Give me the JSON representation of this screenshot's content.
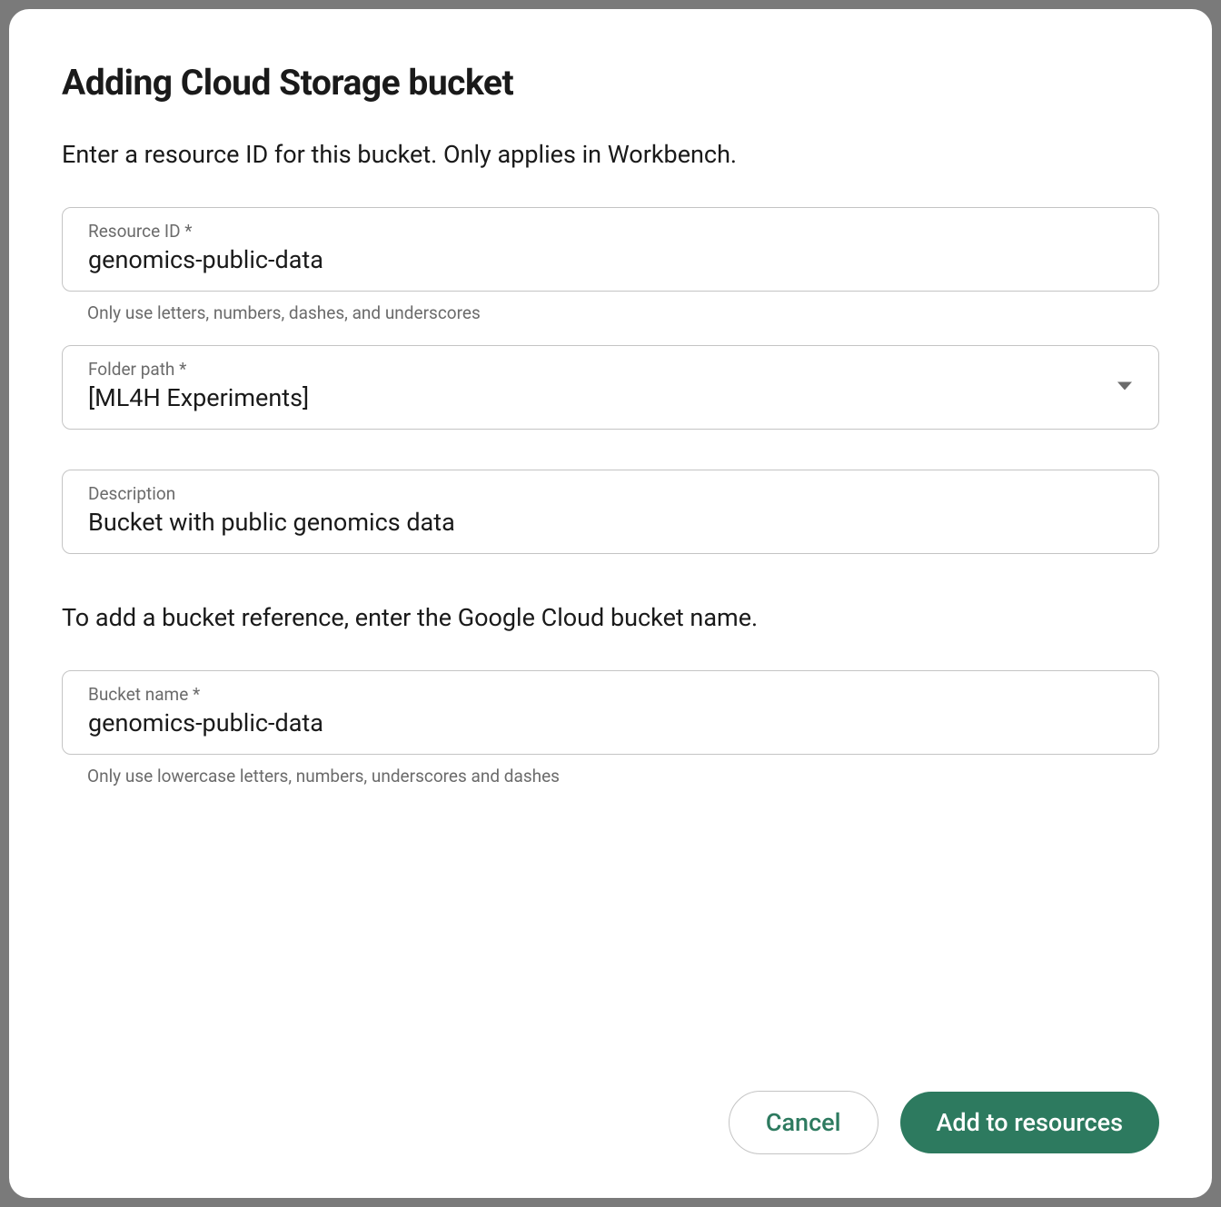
{
  "dialog": {
    "title": "Adding Cloud Storage bucket",
    "subtitle": "Enter a resource ID for this bucket. Only applies in Workbench.",
    "instruction": "To add a bucket reference, enter the Google Cloud bucket name."
  },
  "fields": {
    "resource_id": {
      "label": "Resource ID *",
      "value": "genomics-public-data",
      "helper": "Only use letters, numbers, dashes, and underscores"
    },
    "folder_path": {
      "label": "Folder path *",
      "value": "[ML4H Experiments]"
    },
    "description": {
      "label": "Description",
      "value": "Bucket with public genomics data"
    },
    "bucket_name": {
      "label": "Bucket name *",
      "value": "genomics-public-data",
      "helper": "Only use lowercase letters, numbers, underscores and dashes"
    }
  },
  "buttons": {
    "cancel": "Cancel",
    "submit": "Add to resources"
  }
}
